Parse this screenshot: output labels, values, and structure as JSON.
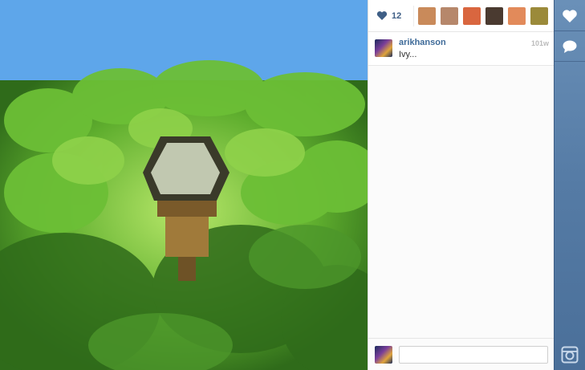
{
  "likes": {
    "count": "12",
    "avatars": [
      {
        "name": "liker-1",
        "color": "#c98a5a"
      },
      {
        "name": "liker-2",
        "color": "#b6876b"
      },
      {
        "name": "liker-3",
        "color": "#d9663f"
      },
      {
        "name": "liker-4",
        "color": "#4a3a30"
      },
      {
        "name": "liker-5",
        "color": "#e28a5a"
      },
      {
        "name": "liker-6",
        "color": "#9b8a3a"
      }
    ]
  },
  "caption": {
    "username": "arikhanson",
    "time": "101w",
    "text": "Ivy..."
  },
  "comment": {
    "placeholder": ""
  },
  "colors": {
    "accent": "#3f6b99",
    "rail": "#557ba5"
  },
  "icons": [
    "heart-icon",
    "comment-bubble-icon",
    "camera-icon"
  ]
}
